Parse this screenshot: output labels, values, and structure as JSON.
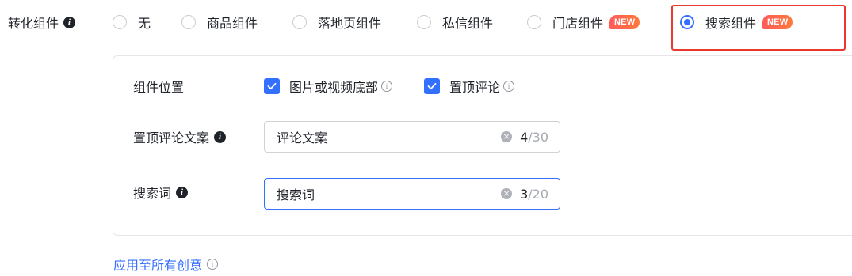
{
  "conversion": {
    "label": "转化组件",
    "options": [
      {
        "label": "无",
        "selected": false,
        "badge": ""
      },
      {
        "label": "商品组件",
        "selected": false,
        "badge": ""
      },
      {
        "label": "落地页组件",
        "selected": false,
        "badge": ""
      },
      {
        "label": "私信组件",
        "selected": false,
        "badge": ""
      },
      {
        "label": "门店组件",
        "selected": false,
        "badge": "NEW"
      },
      {
        "label": "搜索组件",
        "selected": true,
        "badge": "NEW"
      }
    ]
  },
  "panel": {
    "position": {
      "label": "组件位置",
      "options": [
        {
          "label": "图片或视频底部",
          "checked": true
        },
        {
          "label": "置顶评论",
          "checked": true
        }
      ]
    },
    "pinned_comment": {
      "label": "置顶评论文案",
      "value": "评论文案",
      "count": "4",
      "max": "/30"
    },
    "search_term": {
      "label": "搜索词",
      "value": "搜索词",
      "count": "3",
      "max": "/20"
    }
  },
  "apply_all": {
    "label": "应用至所有创意"
  },
  "colors": {
    "accent": "#3370ff",
    "highlight": "#e8392e",
    "badge": "#ff5a5a"
  }
}
